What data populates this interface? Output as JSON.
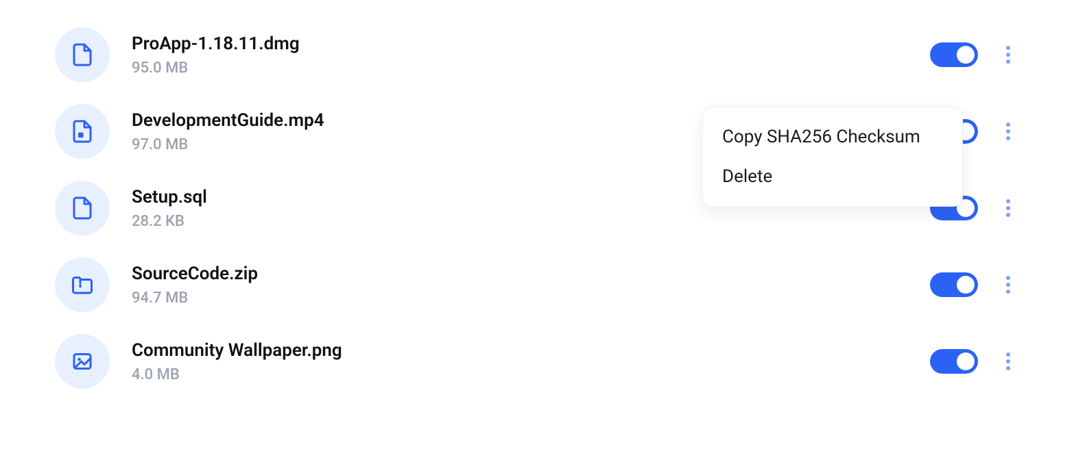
{
  "files": [
    {
      "name": "ProApp-1.18.11.dmg",
      "size": "95.0 MB",
      "icon": "file",
      "toggleOn": true
    },
    {
      "name": "DevelopmentGuide.mp4",
      "size": "97.0 MB",
      "icon": "video",
      "toggleOn": true
    },
    {
      "name": "Setup.sql",
      "size": "28.2 KB",
      "icon": "file",
      "toggleOn": true
    },
    {
      "name": "SourceCode.zip",
      "size": "94.7 MB",
      "icon": "archive",
      "toggleOn": true
    },
    {
      "name": "Community Wallpaper.png",
      "size": "4.0 MB",
      "icon": "image",
      "toggleOn": true
    }
  ],
  "contextMenu": {
    "items": [
      {
        "label": "Copy SHA256 Checksum"
      },
      {
        "label": "Delete"
      }
    ]
  }
}
